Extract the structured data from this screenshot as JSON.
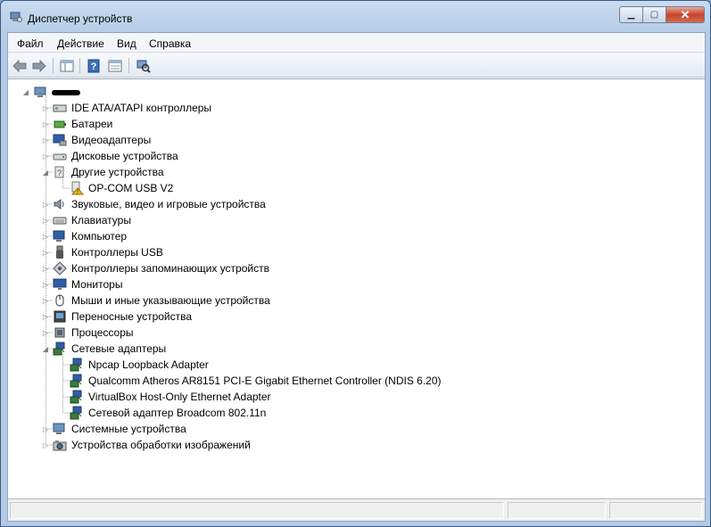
{
  "window": {
    "title": "Диспетчер устройств"
  },
  "menu": [
    "Файл",
    "Действие",
    "Вид",
    "Справка"
  ],
  "root_label": "",
  "tree": [
    {
      "label": "IDE ATA/ATAPI контроллеры",
      "icon": "ide-controller-icon",
      "expanded": false
    },
    {
      "label": "Батареи",
      "icon": "battery-icon",
      "expanded": false
    },
    {
      "label": "Видеоадаптеры",
      "icon": "display-adapter-icon",
      "expanded": false
    },
    {
      "label": "Дисковые устройства",
      "icon": "disk-drive-icon",
      "expanded": false
    },
    {
      "label": "Другие устройства",
      "icon": "other-devices-icon",
      "expanded": true,
      "children": [
        {
          "label": "OP-COM USB V2",
          "icon": "warning-device-icon"
        }
      ]
    },
    {
      "label": "Звуковые, видео и игровые устройства",
      "icon": "sound-icon",
      "expanded": false
    },
    {
      "label": "Клавиатуры",
      "icon": "keyboard-icon",
      "expanded": false
    },
    {
      "label": "Компьютер",
      "icon": "computer-icon",
      "expanded": false
    },
    {
      "label": "Контроллеры USB",
      "icon": "usb-icon",
      "expanded": false
    },
    {
      "label": "Контроллеры запоминающих устройств",
      "icon": "storage-controller-icon",
      "expanded": false
    },
    {
      "label": "Мониторы",
      "icon": "monitor-icon",
      "expanded": false
    },
    {
      "label": "Мыши и иные указывающие устройства",
      "icon": "mouse-icon",
      "expanded": false
    },
    {
      "label": "Переносные устройства",
      "icon": "portable-device-icon",
      "expanded": false
    },
    {
      "label": "Процессоры",
      "icon": "processor-icon",
      "expanded": false
    },
    {
      "label": "Сетевые адаптеры",
      "icon": "network-adapter-icon",
      "expanded": true,
      "children": [
        {
          "label": "Npcap Loopback Adapter",
          "icon": "network-adapter-icon"
        },
        {
          "label": "Qualcomm Atheros AR8151 PCI-E Gigabit Ethernet Controller (NDIS 6.20)",
          "icon": "network-adapter-icon"
        },
        {
          "label": "VirtualBox Host-Only Ethernet Adapter",
          "icon": "network-adapter-icon"
        },
        {
          "label": "Сетевой адаптер Broadcom 802.11n",
          "icon": "network-adapter-icon"
        }
      ]
    },
    {
      "label": "Системные устройства",
      "icon": "system-devices-icon",
      "expanded": false
    },
    {
      "label": "Устройства обработки изображений",
      "icon": "imaging-device-icon",
      "expanded": false
    }
  ],
  "colors": {
    "title_bar": "#b8cfe8",
    "close_button": "#c7432b",
    "tree_bg": "#ffffff",
    "warning": "#f2c200"
  }
}
